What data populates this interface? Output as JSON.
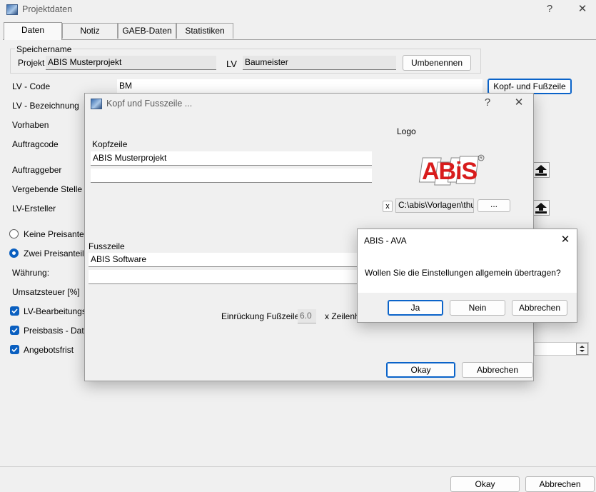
{
  "main": {
    "title": "Projektdaten",
    "help": "?",
    "close": "✕",
    "tabs": [
      {
        "label": "Daten"
      },
      {
        "label": "Notiz"
      },
      {
        "label": "GAEB-Daten"
      },
      {
        "label": "Statistiken"
      }
    ],
    "speichername": {
      "group_label": "Speichername",
      "projekt_label": "Projekt",
      "projekt_value": "ABIS Musterprojekt",
      "lv_label": "LV",
      "lv_value": "Baumeister",
      "rename_button": "Umbenennen"
    },
    "fields": {
      "lv_code_label": "LV - Code",
      "lv_code_value": "BM",
      "lv_bezeichnung_label": "LV - Bezeichnung",
      "vorhaben_label": "Vorhaben",
      "auftragcode_label": "Auftragcode",
      "auftraggeber_label": "Auftraggeber",
      "vergebende_stelle_label": "Vergebende Stelle",
      "lv_ersteller_label": "LV-Ersteller",
      "waehrung_label": "Währung:",
      "umsatzsteuer_label": "Umsatzsteuer [%]"
    },
    "header_footer_button": "Kopf- und Fußzeile",
    "radios": [
      {
        "label": "Keine Preisanteile",
        "selected": false
      },
      {
        "label": "Zwei Preisanteile",
        "selected": true
      }
    ],
    "checkboxes": [
      {
        "label": "LV-Bearbeitungsst",
        "checked": true
      },
      {
        "label": "Preisbasis - Datum",
        "checked": true
      },
      {
        "label": "Angebotsfrist",
        "checked": true
      }
    ],
    "ok_button": "Okay",
    "cancel_button": "Abbrechen"
  },
  "kopf_dialog": {
    "title": "Kopf und Fusszeile ...",
    "help": "?",
    "close": "✕",
    "kopfzeile_label": "Kopfzeile",
    "kopfzeile_line1": "ABIS Musterprojekt",
    "kopfzeile_line2": "",
    "logo_label": "Logo",
    "logo_text": "ABiS",
    "logo_reg": "R",
    "logo_clear": "x",
    "logo_path": "C:\\abis\\Vorlagen\\thun",
    "browse_button": "...",
    "fusszeile_label": "Fusszeile",
    "fusszeile_line1": "ABIS Software",
    "fusszeile_line2": "",
    "einrueckung_label": "Einrückung Fußzeile :",
    "einrueckung_value": "6.0",
    "zeilenhoehe_label": "x Zeilenh",
    "ok_button": "Okay",
    "cancel_button": "Abbrechen"
  },
  "confirm_dialog": {
    "title": "ABIS - AVA",
    "close": "✕",
    "message": "Wollen Sie die Einstellungen allgemein übertragen?",
    "yes_button": "Ja",
    "no_button": "Nein",
    "cancel_button": "Abbrechen"
  },
  "colors": {
    "accent": "#0a5fc0",
    "logo_red": "#e0201e",
    "window_bg": "#f0f0f0"
  }
}
